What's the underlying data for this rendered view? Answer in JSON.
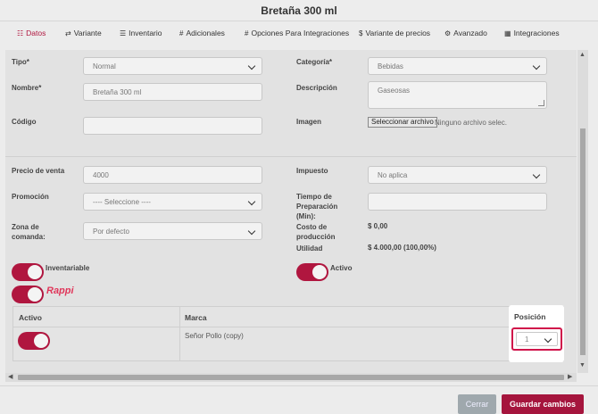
{
  "window": {
    "title": "Bretaña 300 ml"
  },
  "tabs": [
    {
      "label": "Datos",
      "icon": "sliders-icon"
    },
    {
      "label": "Variante",
      "icon": "shuffle-icon"
    },
    {
      "label": "Inventario",
      "icon": "list-icon"
    },
    {
      "label": "Adicionales",
      "icon": "hash-icon"
    },
    {
      "label": "Opciones Para Integraciones",
      "icon": "hash-icon"
    },
    {
      "label": "Variante de precios",
      "icon": "dollar-icon"
    },
    {
      "label": "Avanzado",
      "icon": "gear-icon"
    },
    {
      "label": "Integraciones",
      "icon": "grid-icon"
    }
  ],
  "form": {
    "tipo_label": "Tipo*",
    "tipo_value": "Normal",
    "categoria_label": "Categoría*",
    "categoria_value": "Bebidas",
    "nombre_label": "Nombre*",
    "nombre_value": "Bretaña 300 ml",
    "descripcion_label": "Descripción",
    "descripcion_value": "Gaseosas",
    "codigo_label": "Código",
    "codigo_value": "",
    "imagen_label": "Imagen",
    "imagen_button": "Seleccionar archivo",
    "imagen_status": "Ninguno archivo selec.",
    "precio_label": "Precio de venta",
    "precio_value": "4000",
    "impuesto_label": "Impuesto",
    "impuesto_value": "No aplica",
    "promocion_label": "Promoción",
    "promocion_value": "---- Seleccione ----",
    "tiempo_label_1": "Tiempo de",
    "tiempo_label_2": "Preparación",
    "tiempo_label_3": "(Min):",
    "tiempo_value": "",
    "zona_label_1": "Zona de",
    "zona_label_2": "comanda:",
    "zona_value": "Por defecto",
    "costo_label_1": "Costo de",
    "costo_label_2": "producción",
    "costo_value": "$ 0,00",
    "utilidad_label": "Utilidad",
    "utilidad_value": "$ 4.000,00 (100,00%)",
    "inventariable_label": "Inventariable",
    "activo_label": "Activo",
    "rappi_logo": "Rappi"
  },
  "table": {
    "headers": [
      "Activo",
      "Marca",
      "Posición"
    ],
    "rows": [
      {
        "marca": "Señor Pollo (copy)",
        "posicion": "1"
      }
    ]
  },
  "footer": {
    "cancel": "Cerrar",
    "save": "Guardar cambios"
  },
  "colors": {
    "accent": "#b0163f",
    "highlight": "#d0144a",
    "cancel": "#9fa8ad"
  }
}
